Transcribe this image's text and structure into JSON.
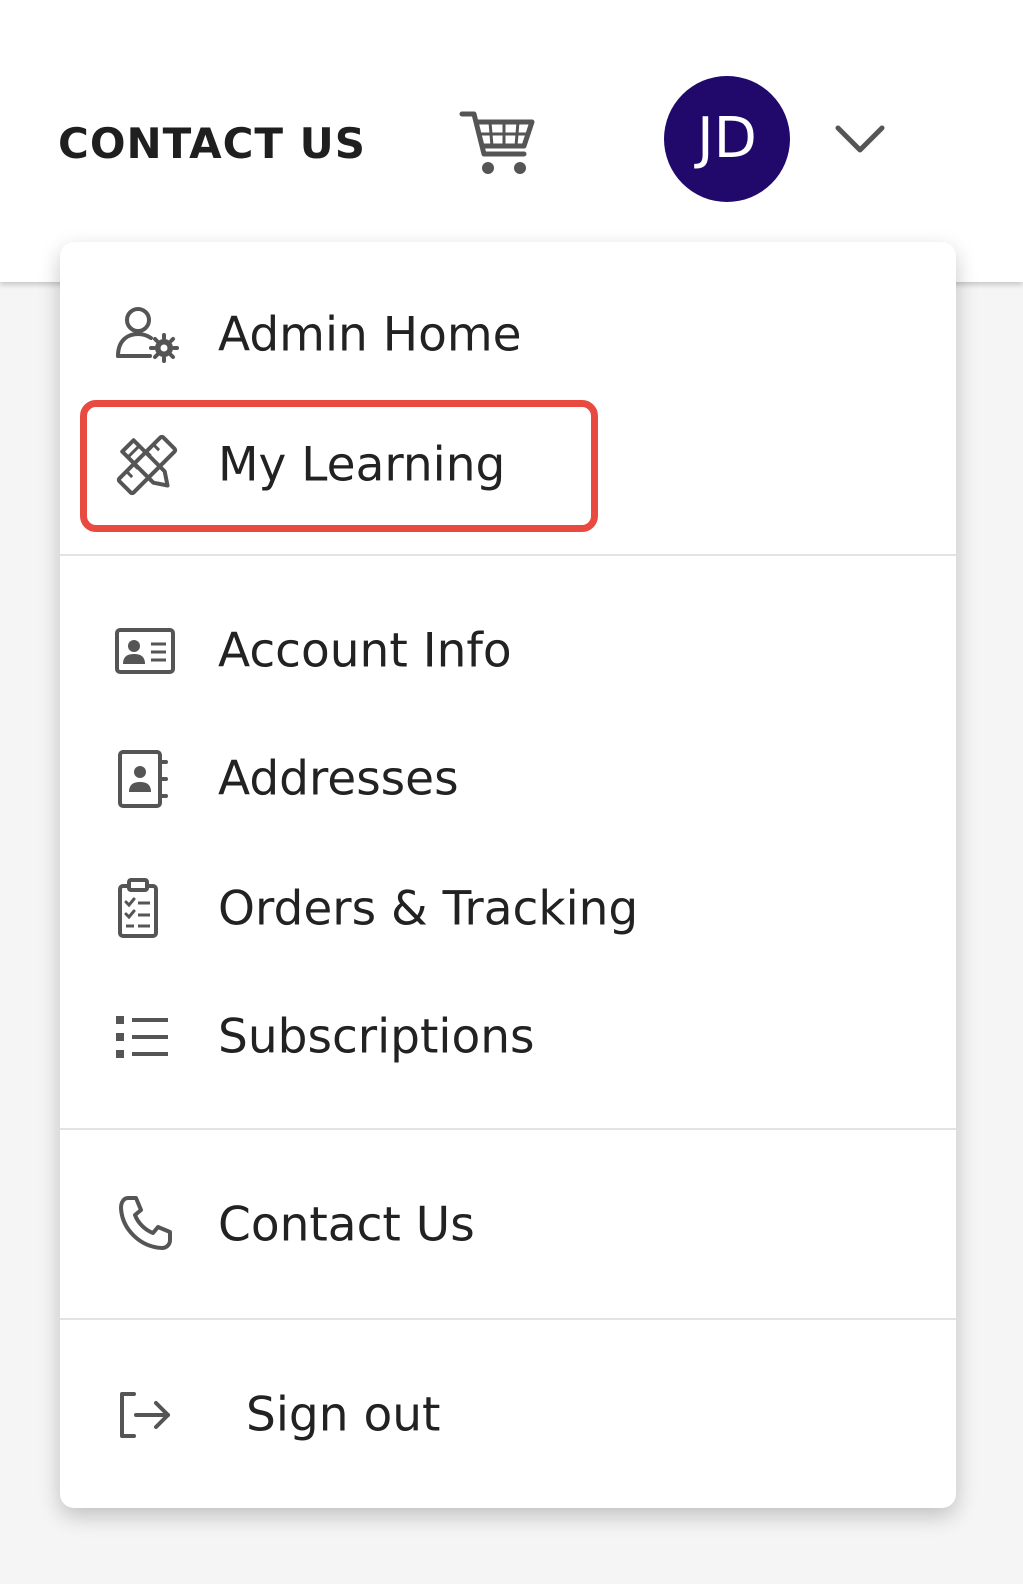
{
  "header": {
    "contact_label": "CONTACT US",
    "avatar_initials": "JD",
    "avatar_color": "#21096b",
    "cart_icon": "cart-icon",
    "chevron_icon": "chevron-down-icon"
  },
  "menu": {
    "items": [
      {
        "label": "Admin Home",
        "icon": "user-gear-icon"
      },
      {
        "label": "My Learning",
        "icon": "pencil-ruler-icon",
        "highlighted": true,
        "highlight_color": "#e84a3f"
      },
      {
        "label": "Account Info",
        "icon": "id-card-icon"
      },
      {
        "label": "Addresses",
        "icon": "address-book-icon"
      },
      {
        "label": "Orders & Tracking",
        "icon": "clipboard-list-icon"
      },
      {
        "label": "Subscriptions",
        "icon": "list-icon"
      },
      {
        "label": "Contact Us",
        "icon": "phone-icon"
      },
      {
        "label": "Sign out",
        "icon": "sign-out-icon"
      }
    ]
  }
}
